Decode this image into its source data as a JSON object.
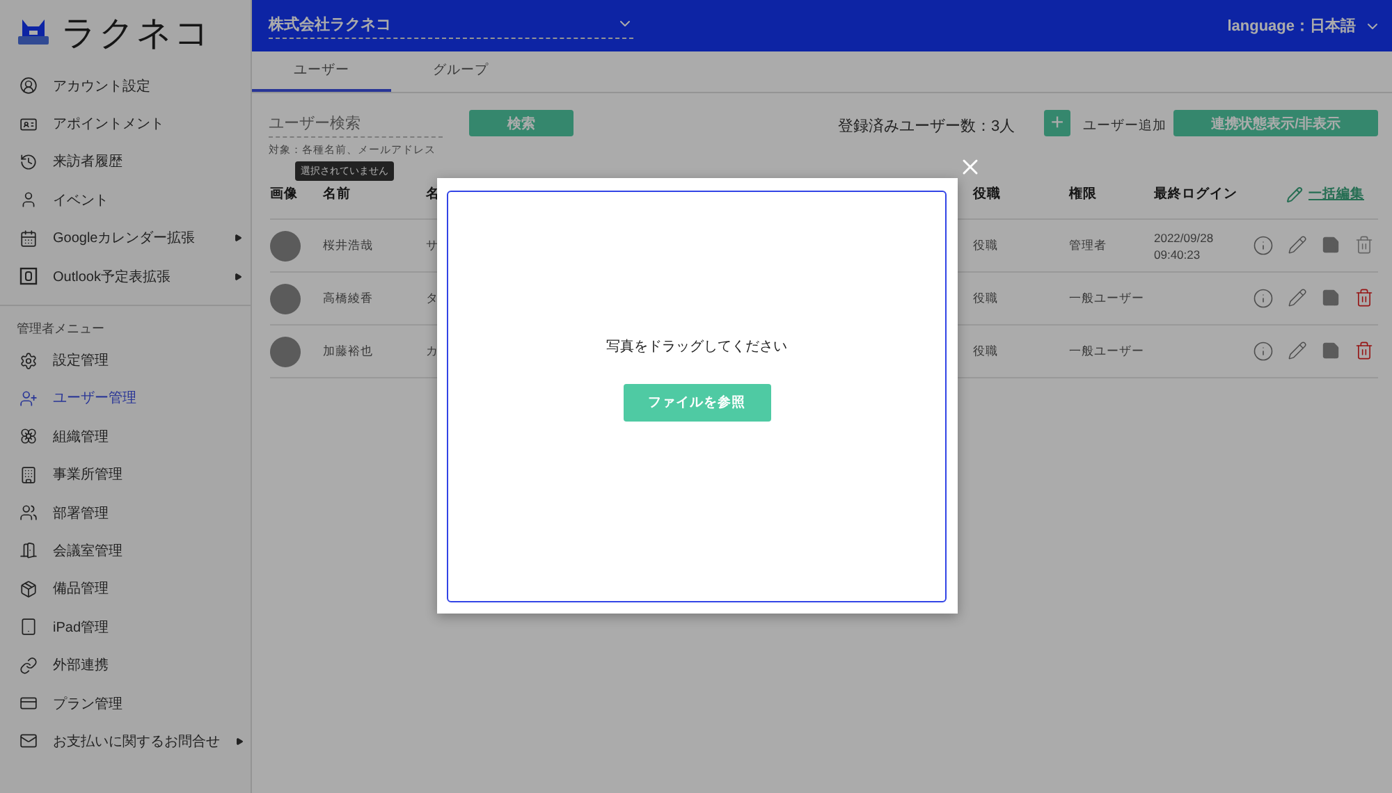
{
  "sidebar": {
    "logo": "ラクネコ",
    "items": [
      {
        "label": "アカウント設定",
        "selected": false,
        "submenu": false
      },
      {
        "label": "アポイントメント",
        "selected": false,
        "submenu": false
      },
      {
        "label": "来訪者履歴",
        "selected": false,
        "submenu": false
      },
      {
        "label": "イベント",
        "selected": false,
        "submenu": false
      },
      {
        "label": "Googleカレンダー拡張",
        "selected": false,
        "submenu": true
      },
      {
        "label": "Outlook予定表拡張",
        "selected": false,
        "submenu": true
      }
    ],
    "admin_heading": "管理者メニュー",
    "admin_items": [
      {
        "label": "設定管理",
        "selected": false,
        "submenu": false
      },
      {
        "label": "ユーザー管理",
        "selected": true,
        "submenu": false
      },
      {
        "label": "組織管理",
        "selected": false,
        "submenu": false
      },
      {
        "label": "事業所管理",
        "selected": false,
        "submenu": false
      },
      {
        "label": "部署管理",
        "selected": false,
        "submenu": false
      },
      {
        "label": "会議室管理",
        "selected": false,
        "submenu": false
      },
      {
        "label": "備品管理",
        "selected": false,
        "submenu": false
      },
      {
        "label": "iPad管理",
        "selected": false,
        "submenu": false
      },
      {
        "label": "外部連携",
        "selected": false,
        "submenu": false
      },
      {
        "label": "プラン管理",
        "selected": false,
        "submenu": false
      },
      {
        "label": "お支払いに関するお問合せ",
        "selected": false,
        "submenu": true
      }
    ]
  },
  "header": {
    "company": "株式会社ラクネコ",
    "language": "language：日本語"
  },
  "tabs": [
    {
      "label": "ユーザー",
      "selected": true
    },
    {
      "label": "グループ",
      "selected": false
    }
  ],
  "search": {
    "placeholder": "ユーザー検索",
    "hint": "対象：各種名前、メールアドレス",
    "button": "検索",
    "tooltip": "選択されていません"
  },
  "count": "登録済みユーザー数：3人",
  "add_user": {
    "icon": "+",
    "label": "ユーザー追加"
  },
  "toggle_button": "連携状態表示/非表示",
  "table": {
    "columns": [
      "画像",
      "名前",
      "名",
      "役職",
      "権限",
      "最終ログイン"
    ],
    "bulk_edit": "一括編集",
    "rows": [
      {
        "name": "桜井浩哉",
        "column_3": "サ",
        "position": "役職",
        "role": "管理者",
        "last_login": [
          "2022/09/28",
          "09:40:23"
        ],
        "deletable": false
      },
      {
        "name": "高橋綾香",
        "column_3": "タ",
        "position": "役職",
        "role": "一般ユーザー",
        "last_login": [],
        "deletable": true
      },
      {
        "name": "加藤裕也",
        "column_3": "カ",
        "position": "役職",
        "role": "一般ユーザー",
        "last_login": [],
        "deletable": true
      }
    ]
  },
  "dialog": {
    "message": "写真をドラッグしてください",
    "button": "ファイルを参照"
  }
}
